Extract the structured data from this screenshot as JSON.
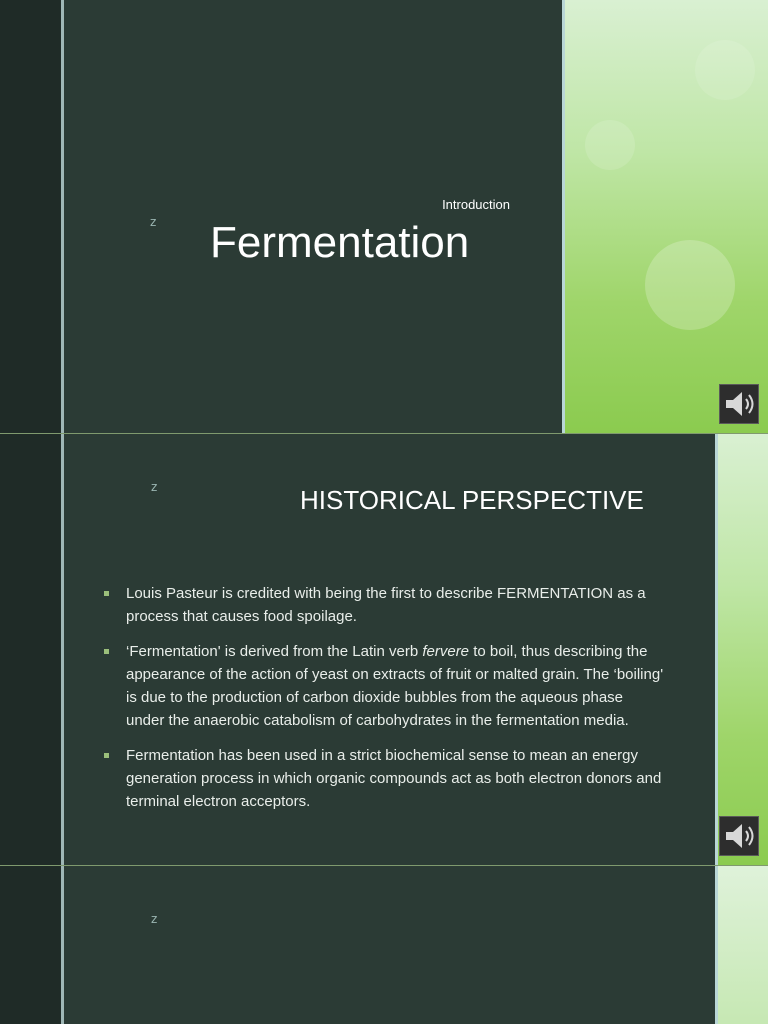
{
  "slide1": {
    "marker": "z",
    "subtitle": "Introduction",
    "title": "Fermentation",
    "audio_icon": "speaker-icon"
  },
  "slide2": {
    "marker": "z",
    "heading": "HISTORICAL PERSPECTIVE",
    "bullets": [
      {
        "text": "Louis Pasteur is credited with being the first to describe FERMENTATION as a process that causes food spoilage."
      },
      {
        "before": "‘Fermentation' is derived from the Latin verb ",
        "italic": "fervere",
        "after": " to boil, thus describing the appearance of the action of yeast on extracts of fruit or malted grain. The ‘boiling' is due to the production of carbon dioxide bubbles from the aqueous phase under the anaerobic catabolism of carbohydrates in the fermentation media."
      },
      {
        "text": "Fermentation has been used in a strict biochemical sense to mean an energy generation process in which organic compounds act as both electron donors and terminal electron acceptors."
      }
    ],
    "audio_icon": "speaker-icon"
  },
  "slide3": {
    "marker": "z"
  },
  "colors": {
    "slide_bg": "#2b3b35",
    "accent_green": "#9fd56a",
    "bullet": "#9bbf7b"
  }
}
